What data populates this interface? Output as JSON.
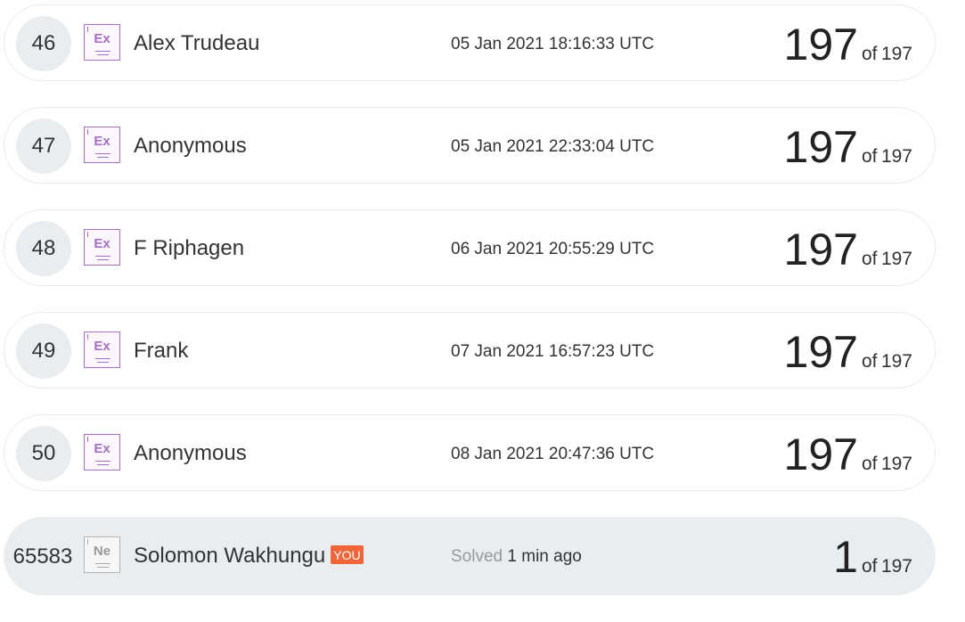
{
  "rows": [
    {
      "rank": "46",
      "badge": "Ex",
      "name": "Alex Trudeau",
      "time": "05 Jan 2021 18:16:33 UTC",
      "score": "197",
      "of": "of",
      "total": "197"
    },
    {
      "rank": "47",
      "badge": "Ex",
      "name": "Anonymous",
      "time": "05 Jan 2021 22:33:04 UTC",
      "score": "197",
      "of": "of",
      "total": "197"
    },
    {
      "rank": "48",
      "badge": "Ex",
      "name": "F Riphagen",
      "time": "06 Jan 2021 20:55:29 UTC",
      "score": "197",
      "of": "of",
      "total": "197"
    },
    {
      "rank": "49",
      "badge": "Ex",
      "name": "Frank",
      "time": "07 Jan 2021 16:57:23 UTC",
      "score": "197",
      "of": "of",
      "total": "197"
    },
    {
      "rank": "50",
      "badge": "Ex",
      "name": "Anonymous",
      "time": "08 Jan 2021 20:47:36 UTC",
      "score": "197",
      "of": "of",
      "total": "197"
    }
  ],
  "me": {
    "rank": "65583",
    "badge": "Ne",
    "name": "Solomon Wakhungu",
    "you_label": "YOU",
    "solved_label": "Solved",
    "solved_time": "1 min ago",
    "score": "1",
    "of": "of",
    "total": "197"
  },
  "colors": {
    "expert_badge": "#a56fc4",
    "novice_badge": "#aaaaaa",
    "you_badge": "#f0653a",
    "row_highlight": "#e9edf0"
  }
}
